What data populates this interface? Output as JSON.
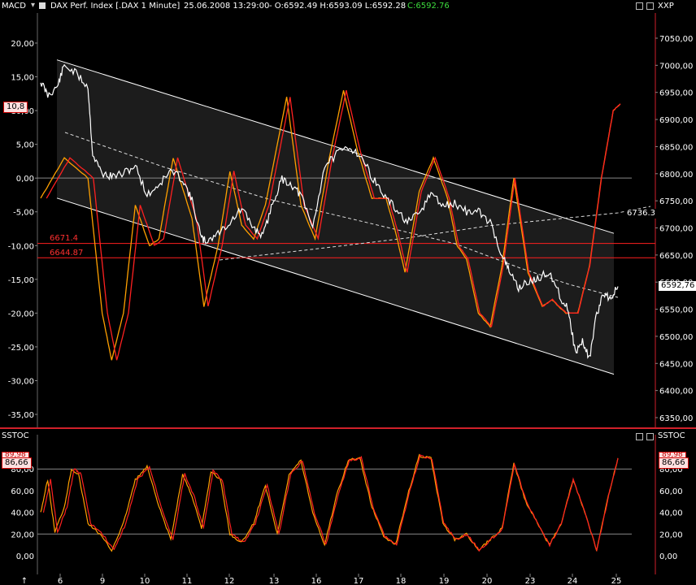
{
  "header": {
    "macd_label": "MACD",
    "title": "DAX Perf. Index [.DAX  1 Minute]",
    "datetime": "25.06.2008 13:29:00",
    "ohl": "- O:6592.49 H:6593.09 L:6592.28",
    "close": "C:6592.76",
    "xxp_label": "XXP",
    "sstoc_left": "SSTOC",
    "sstoc_right": "SSTOC"
  },
  "tags": {
    "macd_value": "10,8",
    "price_last": "6592,76",
    "ma_value": "6736.3",
    "hline1": "6671.4",
    "hline2": "6644.87",
    "stoc_left": "86,66",
    "stoc_right": "86,66",
    "stoc_left_top": "89,98",
    "stoc_right_top": "89,98"
  },
  "colors": {
    "background": "#000000",
    "separator": "#d0202a",
    "price": "#ffffff",
    "signal_line": "#ff2020",
    "macd_line": "#ffa000",
    "channel_fill": "#1c1c1c",
    "hline": "#ff1f1f",
    "close_green": "#3ddc3d"
  },
  "chart_data": [
    {
      "type": "line",
      "title": "DAX Perf. Index [.DAX  1 Minute]",
      "left_axis": {
        "name": "MACD",
        "ticks": [
          "20,00",
          "15,00",
          "10,00",
          "5,00",
          "0,00",
          "-5,00",
          "-10,00",
          "-15,00",
          "-20,00",
          "-25,00",
          "-30,00",
          "-35,00"
        ]
      },
      "right_axis": {
        "name": "XXP",
        "ticks": [
          "7050,00",
          "7000,00",
          "6950,00",
          "6900,00",
          "6850,00",
          "6800,00",
          "6750,00",
          "6700,00",
          "6650,00",
          "6600,00",
          "6550,00",
          "6500,00",
          "6450,00",
          "6400,00",
          "6350,00"
        ]
      },
      "x_ticks": [
        "6",
        "9",
        "10",
        "11",
        "12",
        "13",
        "16",
        "17",
        "18",
        "19",
        "20",
        "23",
        "24",
        "25"
      ],
      "price_series": [
        {
          "x": 0,
          "y": 6970
        },
        {
          "x": 0.3,
          "y": 6945
        },
        {
          "x": 0.7,
          "y": 6960
        },
        {
          "x": 1.0,
          "y": 7000
        },
        {
          "x": 1.5,
          "y": 6985
        },
        {
          "x": 2.0,
          "y": 6960
        },
        {
          "x": 2.2,
          "y": 6835
        },
        {
          "x": 2.6,
          "y": 6800
        },
        {
          "x": 3.0,
          "y": 6795
        },
        {
          "x": 3.5,
          "y": 6800
        },
        {
          "x": 4.0,
          "y": 6815
        },
        {
          "x": 4.5,
          "y": 6760
        },
        {
          "x": 5.0,
          "y": 6780
        },
        {
          "x": 5.5,
          "y": 6805
        },
        {
          "x": 6.0,
          "y": 6790
        },
        {
          "x": 6.4,
          "y": 6750
        },
        {
          "x": 6.8,
          "y": 6680
        },
        {
          "x": 7.0,
          "y": 6675
        },
        {
          "x": 7.5,
          "y": 6690
        },
        {
          "x": 8.0,
          "y": 6710
        },
        {
          "x": 8.5,
          "y": 6735
        },
        {
          "x": 9.0,
          "y": 6700
        },
        {
          "x": 9.4,
          "y": 6685
        },
        {
          "x": 9.8,
          "y": 6745
        },
        {
          "x": 10.2,
          "y": 6790
        },
        {
          "x": 10.6,
          "y": 6780
        },
        {
          "x": 11.0,
          "y": 6760
        },
        {
          "x": 11.5,
          "y": 6700
        },
        {
          "x": 12.0,
          "y": 6815
        },
        {
          "x": 12.5,
          "y": 6835
        },
        {
          "x": 13.0,
          "y": 6850
        },
        {
          "x": 13.5,
          "y": 6835
        },
        {
          "x": 14.0,
          "y": 6795
        },
        {
          "x": 14.5,
          "y": 6760
        },
        {
          "x": 15.0,
          "y": 6735
        },
        {
          "x": 15.5,
          "y": 6710
        },
        {
          "x": 16.0,
          "y": 6725
        },
        {
          "x": 16.5,
          "y": 6765
        },
        {
          "x": 17.0,
          "y": 6740
        },
        {
          "x": 17.5,
          "y": 6745
        },
        {
          "x": 18.0,
          "y": 6730
        },
        {
          "x": 18.5,
          "y": 6730
        },
        {
          "x": 19.0,
          "y": 6710
        },
        {
          "x": 19.5,
          "y": 6650
        },
        {
          "x": 19.8,
          "y": 6620
        },
        {
          "x": 20.2,
          "y": 6590
        },
        {
          "x": 20.6,
          "y": 6600
        },
        {
          "x": 21.0,
          "y": 6605
        },
        {
          "x": 21.5,
          "y": 6620
        },
        {
          "x": 22.0,
          "y": 6570
        },
        {
          "x": 22.3,
          "y": 6550
        },
        {
          "x": 22.6,
          "y": 6470
        },
        {
          "x": 22.9,
          "y": 6490
        },
        {
          "x": 23.2,
          "y": 6460
        },
        {
          "x": 23.5,
          "y": 6540
        },
        {
          "x": 23.8,
          "y": 6580
        },
        {
          "x": 24.1,
          "y": 6570
        },
        {
          "x": 24.4,
          "y": 6592
        }
      ],
      "macd_series": [
        {
          "x": 0,
          "y": -3
        },
        {
          "x": 1.0,
          "y": 3
        },
        {
          "x": 2.0,
          "y": 0
        },
        {
          "x": 2.6,
          "y": -20
        },
        {
          "x": 3.0,
          "y": -27
        },
        {
          "x": 3.5,
          "y": -20
        },
        {
          "x": 4.0,
          "y": -4
        },
        {
          "x": 4.6,
          "y": -10
        },
        {
          "x": 5.0,
          "y": -9
        },
        {
          "x": 5.6,
          "y": 3
        },
        {
          "x": 6.4,
          "y": -6
        },
        {
          "x": 6.9,
          "y": -19
        },
        {
          "x": 7.5,
          "y": -10
        },
        {
          "x": 8.0,
          "y": 1
        },
        {
          "x": 8.5,
          "y": -7
        },
        {
          "x": 9.0,
          "y": -9
        },
        {
          "x": 9.5,
          "y": -4
        },
        {
          "x": 10.4,
          "y": 12
        },
        {
          "x": 11.0,
          "y": -4
        },
        {
          "x": 11.6,
          "y": -9
        },
        {
          "x": 12.2,
          "y": 3
        },
        {
          "x": 12.8,
          "y": 13
        },
        {
          "x": 13.4,
          "y": 4
        },
        {
          "x": 14.0,
          "y": -3
        },
        {
          "x": 14.6,
          "y": -3
        },
        {
          "x": 15.0,
          "y": -8
        },
        {
          "x": 15.4,
          "y": -14
        },
        {
          "x": 16.0,
          "y": -2
        },
        {
          "x": 16.6,
          "y": 3
        },
        {
          "x": 17.2,
          "y": -3
        },
        {
          "x": 17.6,
          "y": -10
        },
        {
          "x": 18.0,
          "y": -12
        },
        {
          "x": 18.5,
          "y": -20
        },
        {
          "x": 19.0,
          "y": -22
        },
        {
          "x": 19.5,
          "y": -13
        },
        {
          "x": 20.0,
          "y": 0
        },
        {
          "x": 20.6,
          "y": -14
        },
        {
          "x": 21.2,
          "y": -19
        },
        {
          "x": 21.6,
          "y": -18
        },
        {
          "x": 22.2,
          "y": -20
        },
        {
          "x": 22.7,
          "y": -20
        },
        {
          "x": 23.2,
          "y": -13
        },
        {
          "x": 23.7,
          "y": 0
        },
        {
          "x": 24.2,
          "y": 10
        },
        {
          "x": 24.5,
          "y": 11
        }
      ],
      "channel": {
        "upper_start": 7010,
        "upper_end": 6690,
        "lower_start": 6755,
        "lower_end": 6430
      },
      "horizontal_lines": [
        6671.4,
        6644.87
      ]
    },
    {
      "type": "line",
      "title": "SSTOC",
      "left_axis_ticks": [
        "80,00",
        "60,00",
        "40,00",
        "20,00",
        "0,00"
      ],
      "reference_lines": [
        80,
        20
      ],
      "k_series": [
        {
          "x": 0,
          "y": 40
        },
        {
          "x": 0.3,
          "y": 70
        },
        {
          "x": 0.6,
          "y": 22
        },
        {
          "x": 1.0,
          "y": 45
        },
        {
          "x": 1.3,
          "y": 80
        },
        {
          "x": 1.6,
          "y": 75
        },
        {
          "x": 2.0,
          "y": 30
        },
        {
          "x": 2.5,
          "y": 20
        },
        {
          "x": 3.0,
          "y": 5
        },
        {
          "x": 3.5,
          "y": 30
        },
        {
          "x": 4.0,
          "y": 70
        },
        {
          "x": 4.5,
          "y": 82
        },
        {
          "x": 5.0,
          "y": 45
        },
        {
          "x": 5.5,
          "y": 15
        },
        {
          "x": 6.0,
          "y": 75
        },
        {
          "x": 6.4,
          "y": 55
        },
        {
          "x": 6.8,
          "y": 25
        },
        {
          "x": 7.2,
          "y": 78
        },
        {
          "x": 7.6,
          "y": 70
        },
        {
          "x": 8.0,
          "y": 20
        },
        {
          "x": 8.5,
          "y": 12
        },
        {
          "x": 9.0,
          "y": 30
        },
        {
          "x": 9.5,
          "y": 65
        },
        {
          "x": 10.0,
          "y": 20
        },
        {
          "x": 10.5,
          "y": 75
        },
        {
          "x": 11.0,
          "y": 88
        },
        {
          "x": 11.5,
          "y": 40
        },
        {
          "x": 12.0,
          "y": 10
        },
        {
          "x": 12.5,
          "y": 55
        },
        {
          "x": 13.0,
          "y": 88
        },
        {
          "x": 13.5,
          "y": 90
        },
        {
          "x": 14.0,
          "y": 45
        },
        {
          "x": 14.5,
          "y": 18
        },
        {
          "x": 15.0,
          "y": 10
        },
        {
          "x": 15.5,
          "y": 55
        },
        {
          "x": 16.0,
          "y": 92
        },
        {
          "x": 16.5,
          "y": 90
        },
        {
          "x": 17.0,
          "y": 30
        },
        {
          "x": 17.5,
          "y": 15
        },
        {
          "x": 18.0,
          "y": 20
        },
        {
          "x": 18.5,
          "y": 5
        },
        {
          "x": 19.0,
          "y": 15
        },
        {
          "x": 19.5,
          "y": 25
        },
        {
          "x": 20.0,
          "y": 85
        },
        {
          "x": 20.5,
          "y": 50
        },
        {
          "x": 21.0,
          "y": 30
        },
        {
          "x": 21.5,
          "y": 10
        },
        {
          "x": 22.0,
          "y": 30
        },
        {
          "x": 22.5,
          "y": 70
        },
        {
          "x": 23.0,
          "y": 40
        },
        {
          "x": 23.5,
          "y": 5
        },
        {
          "x": 24.0,
          "y": 55
        },
        {
          "x": 24.4,
          "y": 90
        }
      ]
    }
  ]
}
